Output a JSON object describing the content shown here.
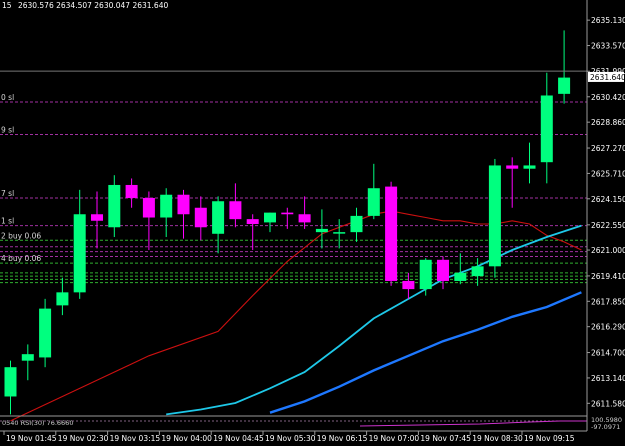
{
  "chart_data": {
    "type": "candlestick",
    "header": {
      "symbol_fragment": "15",
      "ohlc": "2630.576 2634.507 2630.047 2631.640"
    },
    "colors": {
      "background": "#000000",
      "bull": "#00ff7f",
      "bear": "#ff00ff",
      "ma_slow": "#cc1010",
      "ma_mid": "#1ec8e8",
      "ma_long": "#1e78ff",
      "order_buy": "#30b030",
      "order_sell": "#a030a0",
      "bid_line": "#777777",
      "text": "#ffffff"
    },
    "y_axis": {
      "min": 2610.8,
      "max": 2636.0,
      "ticks": [
        "2635.130",
        "2633.570",
        "2631.990",
        "2630.420",
        "2628.860",
        "2627.270",
        "2625.710",
        "2624.150",
        "2622.550",
        "2621.000",
        "2619.410",
        "2617.850",
        "2616.290",
        "2614.700",
        "2613.140",
        "2611.580"
      ],
      "current_price": "2631.640"
    },
    "x_axis": {
      "labels": [
        "19 Nov 01:45",
        "19 Nov 02:30",
        "19 Nov 03:15",
        "19 Nov 04:00",
        "19 Nov 04:45",
        "19 Nov 05:30",
        "19 Nov 06:15",
        "19 Nov 07:00",
        "19 Nov 07:45",
        "19 Nov 08:30",
        "19 Nov 09:15"
      ]
    },
    "candles": [
      {
        "o": 2612.0,
        "h": 2614.2,
        "l": 2610.9,
        "c": 2613.8
      },
      {
        "o": 2614.2,
        "h": 2615.2,
        "l": 2613.0,
        "c": 2614.6
      },
      {
        "o": 2614.4,
        "h": 2618.0,
        "l": 2613.8,
        "c": 2617.4
      },
      {
        "o": 2617.6,
        "h": 2619.3,
        "l": 2617.0,
        "c": 2618.4
      },
      {
        "o": 2618.4,
        "h": 2624.7,
        "l": 2618.0,
        "c": 2623.2
      },
      {
        "o": 2623.2,
        "h": 2624.6,
        "l": 2621.1,
        "c": 2622.8
      },
      {
        "o": 2622.4,
        "h": 2625.6,
        "l": 2621.8,
        "c": 2625.0
      },
      {
        "o": 2625.0,
        "h": 2625.4,
        "l": 2623.6,
        "c": 2624.2
      },
      {
        "o": 2624.2,
        "h": 2624.6,
        "l": 2621.0,
        "c": 2623.0
      },
      {
        "o": 2623.0,
        "h": 2624.8,
        "l": 2621.8,
        "c": 2624.4
      },
      {
        "o": 2624.4,
        "h": 2624.7,
        "l": 2621.7,
        "c": 2623.2
      },
      {
        "o": 2623.6,
        "h": 2624.3,
        "l": 2621.6,
        "c": 2622.4
      },
      {
        "o": 2622.0,
        "h": 2624.3,
        "l": 2620.8,
        "c": 2624.0
      },
      {
        "o": 2624.0,
        "h": 2625.1,
        "l": 2622.4,
        "c": 2622.9
      },
      {
        "o": 2622.9,
        "h": 2623.2,
        "l": 2621.0,
        "c": 2622.6
      },
      {
        "o": 2622.7,
        "h": 2623.3,
        "l": 2622.1,
        "c": 2623.3
      },
      {
        "o": 2623.3,
        "h": 2623.6,
        "l": 2622.3,
        "c": 2623.2
      },
      {
        "o": 2623.2,
        "h": 2624.3,
        "l": 2622.3,
        "c": 2622.7
      },
      {
        "o": 2622.1,
        "h": 2623.5,
        "l": 2621.1,
        "c": 2622.3
      },
      {
        "o": 2622.1,
        "h": 2622.9,
        "l": 2621.1,
        "c": 2622.1
      },
      {
        "o": 2622.1,
        "h": 2623.6,
        "l": 2621.5,
        "c": 2623.1
      },
      {
        "o": 2623.1,
        "h": 2626.3,
        "l": 2622.9,
        "c": 2624.8
      },
      {
        "o": 2624.9,
        "h": 2625.2,
        "l": 2618.8,
        "c": 2619.1
      },
      {
        "o": 2619.1,
        "h": 2619.6,
        "l": 2618.0,
        "c": 2618.6
      },
      {
        "o": 2618.6,
        "h": 2620.5,
        "l": 2618.2,
        "c": 2620.4
      },
      {
        "o": 2620.4,
        "h": 2620.6,
        "l": 2618.6,
        "c": 2619.1
      },
      {
        "o": 2619.1,
        "h": 2620.8,
        "l": 2618.9,
        "c": 2619.6
      },
      {
        "o": 2619.4,
        "h": 2620.5,
        "l": 2618.8,
        "c": 2620.0
      },
      {
        "o": 2620.0,
        "h": 2626.6,
        "l": 2619.3,
        "c": 2626.2
      },
      {
        "o": 2626.2,
        "h": 2626.7,
        "l": 2623.6,
        "c": 2626.0
      },
      {
        "o": 2626.0,
        "h": 2627.6,
        "l": 2625.1,
        "c": 2626.2
      },
      {
        "o": 2626.4,
        "h": 2631.9,
        "l": 2625.1,
        "c": 2630.5
      },
      {
        "o": 2630.6,
        "h": 2634.5,
        "l": 2630.0,
        "c": 2631.6
      }
    ],
    "ma_slow": [
      [
        0,
        2610.5
      ],
      [
        8,
        2614.5
      ],
      [
        12,
        2616.0
      ],
      [
        14,
        2618.2
      ],
      [
        16,
        2620.3
      ],
      [
        18,
        2622.0
      ],
      [
        20,
        2622.8
      ],
      [
        21,
        2623.2
      ],
      [
        22,
        2623.4
      ],
      [
        23,
        2623.2
      ],
      [
        24,
        2623.0
      ],
      [
        25,
        2622.8
      ],
      [
        26,
        2622.8
      ],
      [
        27,
        2622.6
      ],
      [
        28,
        2622.6
      ],
      [
        29,
        2622.8
      ],
      [
        30,
        2622.6
      ],
      [
        31,
        2621.9
      ],
      [
        32,
        2621.5
      ],
      [
        33,
        2621.0
      ]
    ],
    "ma_mid": [
      [
        9,
        2610.9
      ],
      [
        11,
        2611.2
      ],
      [
        13,
        2611.6
      ],
      [
        15,
        2612.5
      ],
      [
        17,
        2613.5
      ],
      [
        19,
        2615.1
      ],
      [
        21,
        2616.8
      ],
      [
        23,
        2618.0
      ],
      [
        25,
        2619.2
      ],
      [
        27,
        2620.0
      ],
      [
        29,
        2621.0
      ],
      [
        31,
        2621.8
      ],
      [
        33,
        2622.5
      ]
    ],
    "ma_long": [
      [
        15,
        2611.0
      ],
      [
        17,
        2611.7
      ],
      [
        19,
        2612.6
      ],
      [
        21,
        2613.6
      ],
      [
        23,
        2614.5
      ],
      [
        25,
        2615.4
      ],
      [
        27,
        2616.1
      ],
      [
        29,
        2616.9
      ],
      [
        31,
        2617.5
      ],
      [
        33,
        2618.4
      ]
    ],
    "order_lines": [
      {
        "price": 2630.1,
        "label": "0 sl",
        "kind": "sell"
      },
      {
        "price": 2628.1,
        "label": "9 sl",
        "kind": "sell"
      },
      {
        "price": 2624.2,
        "label": "7 sl",
        "kind": "sell"
      },
      {
        "price": 2622.5,
        "label": "1 sl",
        "kind": "sell"
      },
      {
        "price": 2621.6,
        "label": "2 buy 0.06",
        "kind": "buy"
      },
      {
        "price": 2621.2,
        "label": "",
        "kind": "sell"
      },
      {
        "price": 2620.9,
        "label": "",
        "kind": "sell"
      },
      {
        "price": 2620.6,
        "label": "",
        "kind": "sell"
      },
      {
        "price": 2620.2,
        "label": "4 buy 0.06",
        "kind": "buy"
      },
      {
        "price": 2619.6,
        "label": "",
        "kind": "buy"
      },
      {
        "price": 2619.4,
        "label": "",
        "kind": "buy"
      },
      {
        "price": 2619.2,
        "label": "",
        "kind": "buy"
      },
      {
        "price": 2619.0,
        "label": "",
        "kind": "buy"
      }
    ],
    "indicator": {
      "label": "0540  RSI(30) 76.6660",
      "axis_labels": [
        "100.5980",
        "-97.0971"
      ]
    }
  }
}
